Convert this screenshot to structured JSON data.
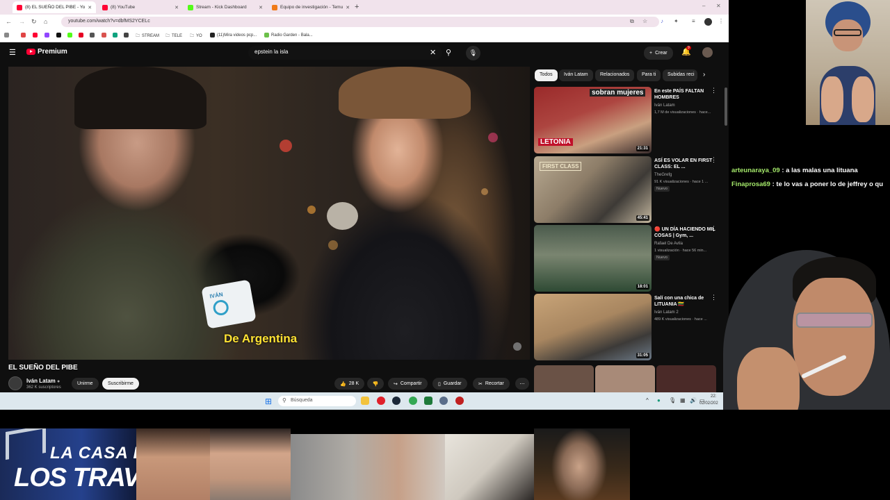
{
  "browser": {
    "tabs": [
      {
        "title": "(8) EL SUEÑO DEL PIBE - Yo",
        "active": true,
        "color": "#ff0033"
      },
      {
        "title": "(8) YouTube",
        "active": false,
        "color": "#ff0033"
      },
      {
        "title": "Stream - Kick Dashboard",
        "active": false,
        "color": "#53fc18"
      },
      {
        "title": "Equipo de investigación - Temu",
        "active": false,
        "color": "#f07b1a"
      }
    ],
    "url": "youtube.com/watch?v=dbfMS2YCELc",
    "bookmarks": [
      "STREAM",
      "TELE",
      "YO",
      "(11)Mira videos pcp...",
      "Radio Garden - Bala..."
    ]
  },
  "youtube": {
    "logo": "Premium",
    "search_query": "epstein la isla",
    "create_label": "Crear",
    "notif_count": "9",
    "video_title": "EL SUEÑO DEL PIBE",
    "subtitle": "De Argentina",
    "mic_label": "IVÁN",
    "channel": {
      "name": "Iván Latam",
      "subs": "362 K suscriptores"
    },
    "join_label": "Unirme",
    "subscribe_label": "Suscribirme",
    "likes": "28 K",
    "share_label": "Compartir",
    "save_label": "Guardar",
    "clip_label": "Recortar",
    "chips": [
      "Todos",
      "Iván Latam",
      "Relacionados",
      "Para ti",
      "Subidas reci"
    ],
    "recommendations": [
      {
        "title": "En este PAÍS FALTAN HOMBRES",
        "channel": "Iván Latam",
        "meta": "1,7 M de visualizaciones · hace...",
        "duration": "21:31",
        "thumb_text": "sobran mujeres",
        "thumb_tag": "LETONIA",
        "badge": ""
      },
      {
        "title": "ASÍ ES VOLAR EN FIRST CLASS: EL ...",
        "channel": "TheGrefg",
        "meta": "91 K visualizaciones · hace 1 ...",
        "duration": "45:41",
        "thumb_text": "FIRST CLASS",
        "badge": "Nuevo"
      },
      {
        "title": "🔴 UN DÍA HACIENDO MIL COSAS | Gym, ...",
        "channel": "Rafael De Avila",
        "meta": "1 visualización · hace 56 min...",
        "duration": "18:01",
        "badge": "Nuevo"
      },
      {
        "title": "Salí con una chica de LITUANIA 🇱🇹",
        "channel": "Iván Latam 2",
        "meta": "489 K visualizaciones · hace ...",
        "duration": "31:05",
        "badge": ""
      }
    ]
  },
  "taskbar": {
    "search_placeholder": "Búsqueda",
    "time": "22:",
    "date": "02/02/202"
  },
  "chat": [
    {
      "user": "arteunaraya_09",
      "message": "a las malas una lituana"
    },
    {
      "user": "Finaprosa69",
      "message": "te lo vas a poner lo de jeffrey o qu"
    }
  ],
  "overlay": {
    "casa_line1": "LA CASA D",
    "casa_line2": "LOS TRAVELOS"
  }
}
